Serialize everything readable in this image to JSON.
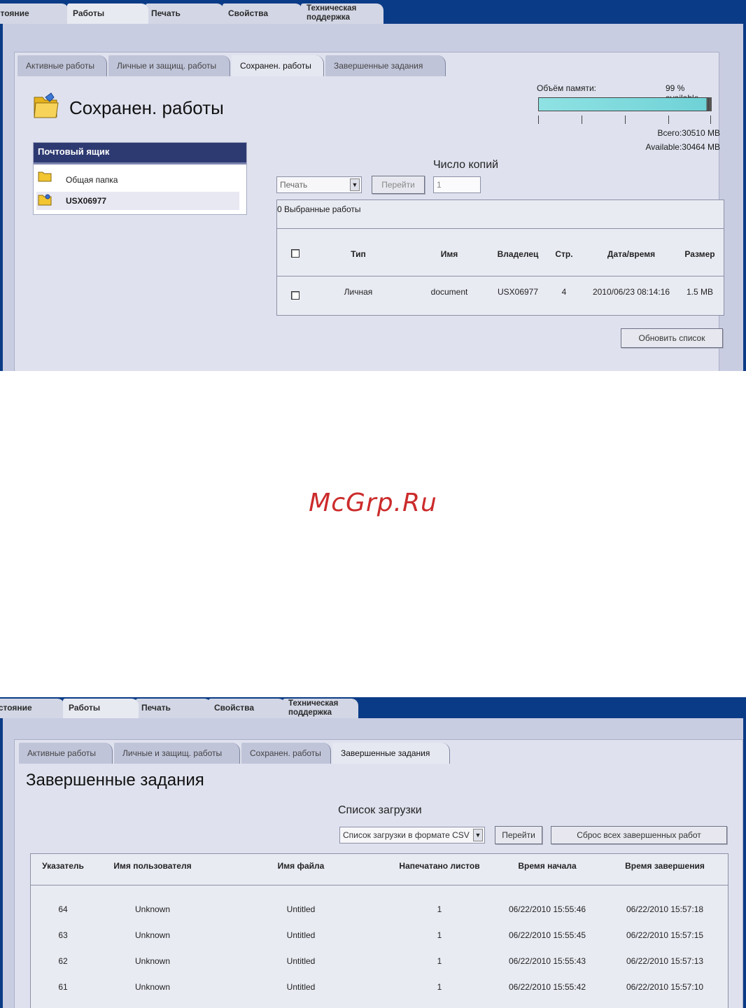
{
  "screen1": {
    "top_tabs": [
      "Состояние",
      "Работы",
      "Печать",
      "Свойства",
      "Техническая поддержка"
    ],
    "sub_tabs": [
      "Активные работы",
      "Личные и защищ. работы",
      "Сохранен. работы",
      "Завершенные задания"
    ],
    "page_title": "Сохранен. работы",
    "mailbox": {
      "header": "Почтовый ящик",
      "items": [
        "Общая папка",
        "USX06977"
      ]
    },
    "memory": {
      "label": "Объём памяти:",
      "available_text": "99 % available",
      "used_fraction": 0.01,
      "total": "Всего:30510 MB",
      "available": "Available:30464 MB"
    },
    "controls": {
      "copies_label": "Число копий",
      "action_select": "Печать",
      "go_button": "Перейти",
      "copies_value": "1"
    },
    "table": {
      "selected_label": "0 Выбранные работы",
      "columns": [
        "Тип",
        "Имя",
        "Владелец",
        "Стр.",
        "Дата/время",
        "Размер"
      ],
      "rows": [
        [
          "Личная",
          "document",
          "USX06977",
          "4",
          "2010/06/23 08:14:16",
          "1.5 MB"
        ]
      ]
    },
    "refresh_button": "Обновить список"
  },
  "watermark": "McGrp.Ru",
  "screen2": {
    "top_tabs": [
      "Состояние",
      "Работы",
      "Печать",
      "Свойства",
      "Техническая поддержка"
    ],
    "sub_tabs": [
      "Активные работы",
      "Личные и защищ. работы",
      "Сохранен. работы",
      "Завершенные задания"
    ],
    "page_title": "Завершенные задания",
    "download_label": "Список загрузки",
    "download_select": "Список загрузки в формате CSV",
    "go_button": "Перейти",
    "reset_button": "Сброс всех завершенных работ",
    "table": {
      "columns": [
        "Указатель",
        "Имя пользователя",
        "Имя файла",
        "Напечатано листов",
        "Время начала",
        "Время завершения"
      ],
      "rows": [
        [
          "64",
          "Unknown",
          "Untitled",
          "1",
          "06/22/2010 15:55:46",
          "06/22/2010 15:57:18"
        ],
        [
          "63",
          "Unknown",
          "Untitled",
          "1",
          "06/22/2010 15:55:45",
          "06/22/2010 15:57:15"
        ],
        [
          "62",
          "Unknown",
          "Untitled",
          "1",
          "06/22/2010 15:55:43",
          "06/22/2010 15:57:13"
        ],
        [
          "61",
          "Unknown",
          "Untitled",
          "1",
          "06/22/2010 15:55:42",
          "06/22/2010 15:57:10"
        ]
      ]
    }
  }
}
